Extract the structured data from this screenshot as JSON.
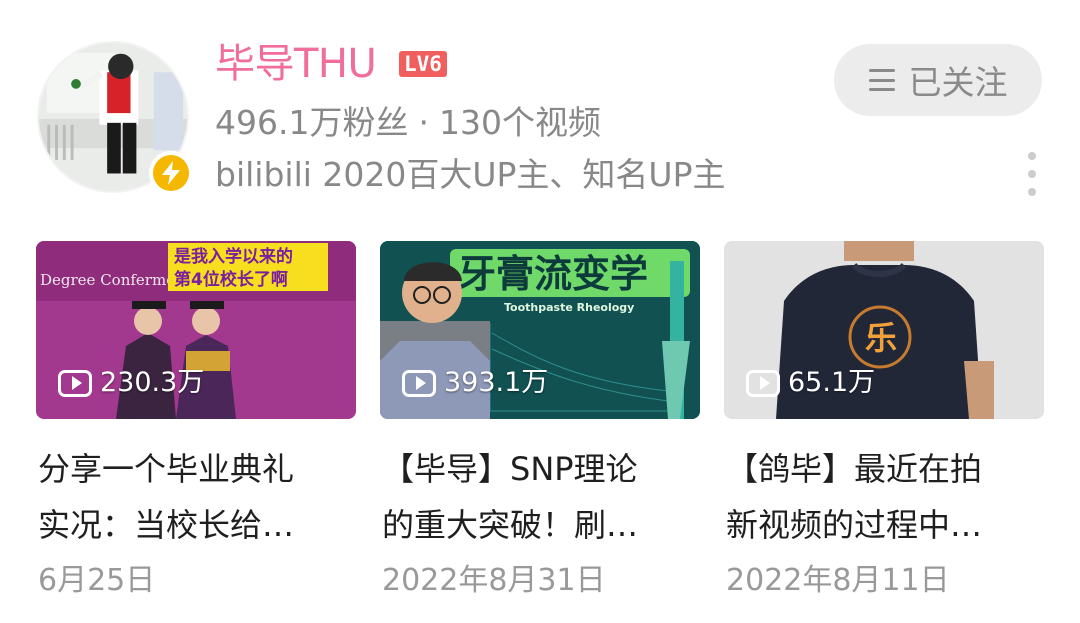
{
  "profile": {
    "username": "毕导THU",
    "level": "LV6",
    "fans": "496.1万粉丝",
    "separator": "·",
    "videos": "130个视频",
    "tagline": "bilibili 2020百大UP主、知名UP主",
    "follow_label": "已关注"
  },
  "colors": {
    "username": "#f06e99",
    "level_badge": "#f05e5e",
    "verified": "#f5b800",
    "muted_text": "#888888"
  },
  "icons": {
    "follow": "menu-icon",
    "verified": "lightning-icon",
    "more": "vertical-dots-icon",
    "views": "play-icon"
  },
  "videos": [
    {
      "views": "230.3万",
      "title_line1": "分享一个毕业典礼",
      "title_line2": "实况：当校长给…",
      "date": "6月25日",
      "thumb_text_1": "是我入学以来的",
      "thumb_text_2": "第4位校长了啊",
      "thumb_text_3": "Degree Conferme"
    },
    {
      "views": "393.1万",
      "title_line1": "【毕导】SNP理论",
      "title_line2": "的重大突破！刷…",
      "date": "2022年8月31日",
      "thumb_text_1": "牙膏流变学",
      "thumb_text_2": "Toothpaste Rheology"
    },
    {
      "views": "65.1万",
      "title_line1": "【鸽毕】最近在拍",
      "title_line2": "新视频的过程中…",
      "date": "2022年8月11日",
      "thumb_text_1": "乐"
    }
  ]
}
